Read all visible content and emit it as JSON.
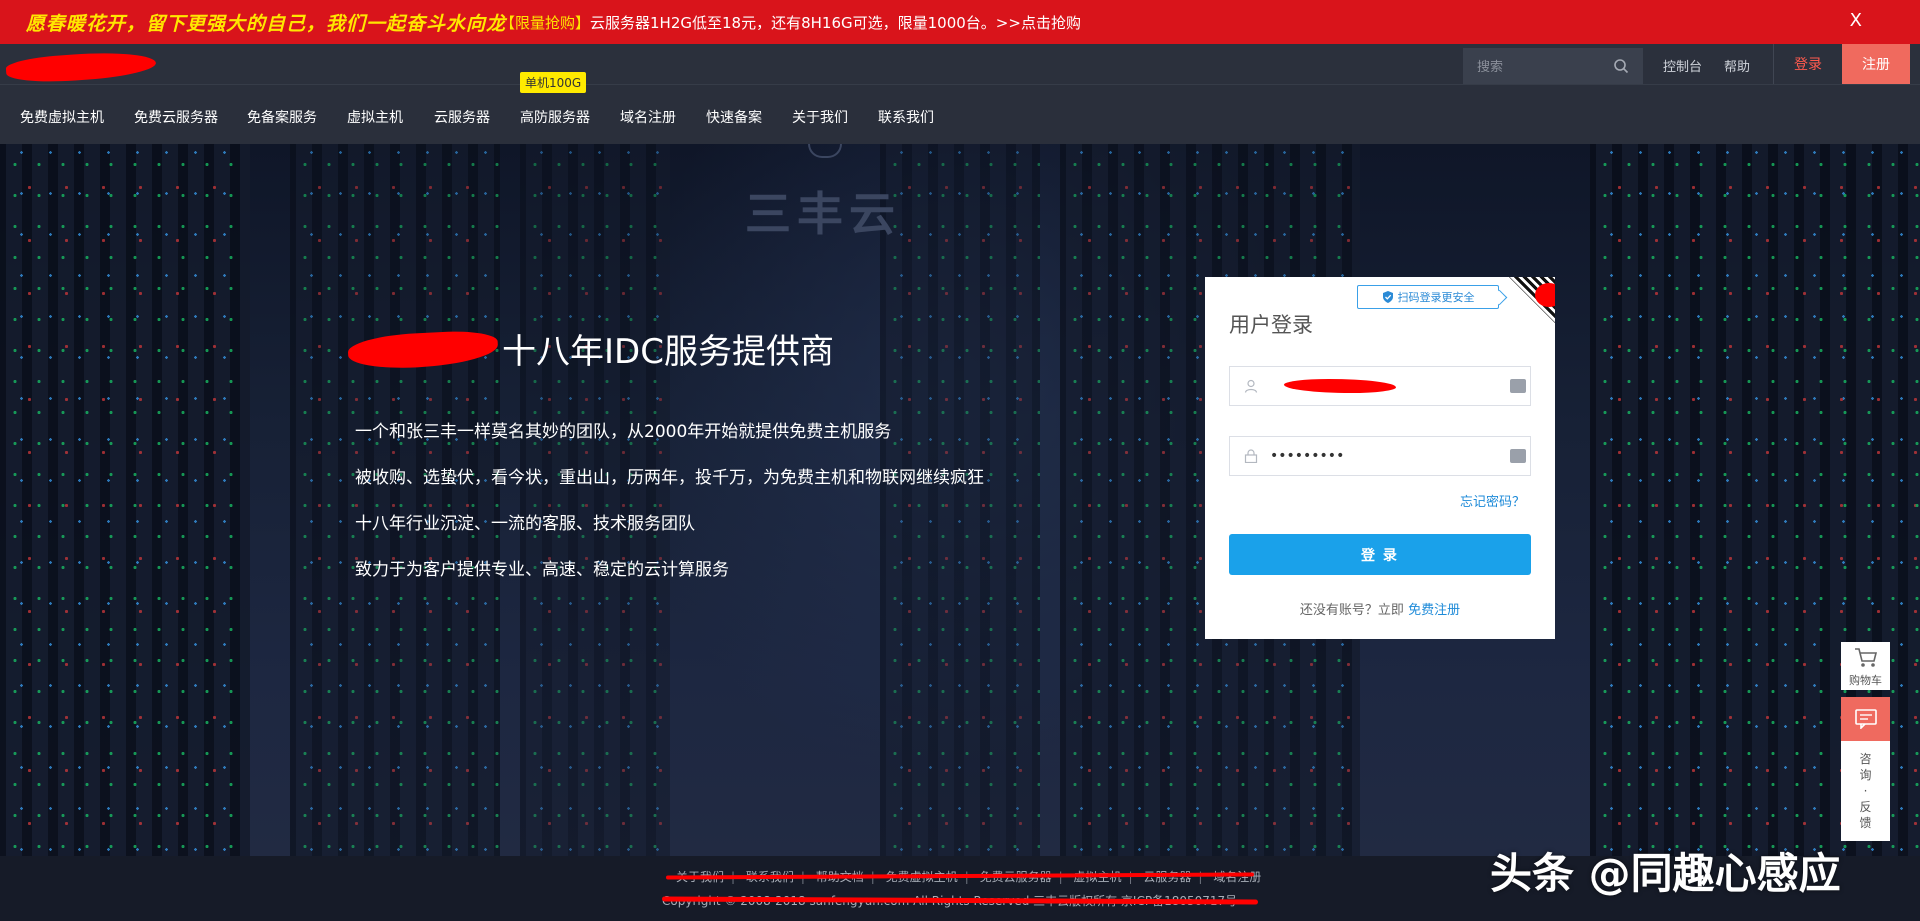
{
  "promo": {
    "slogan": "愿春暖花开，留下更强大的自己，我们一起奋斗水向龙",
    "tag": "【限量抢购】",
    "text": "云服务器1H2G低至18元，还有8H16G可选，限量1000台。>>点击抢购",
    "close": "X"
  },
  "header": {
    "search_placeholder": "搜索",
    "links": {
      "console": "控制台",
      "help": "帮助",
      "login": "登录",
      "register": "注册"
    }
  },
  "nav": {
    "items": [
      "免费虚拟主机",
      "免费云服务器",
      "免备案服务",
      "虚拟主机",
      "云服务器",
      "高防服务器",
      "域名注册",
      "快速备案",
      "关于我们",
      "联系我们"
    ],
    "badge": "单机100G"
  },
  "hero": {
    "wall_brand": "三丰云",
    "title": "十八年IDC服务提供商",
    "lines": [
      "一个和张三丰一样莫名其妙的团队，从2000年开始就提供免费主机服务",
      "被收购、选蛰伏，看今状，重出山，历两年，投千万，为免费主机和物联网继续疯狂",
      "十八年行业沉淀、一流的客服、技术服务团队",
      "致力于为客户提供专业、高速、稳定的云计算服务"
    ]
  },
  "login": {
    "qr_tip": "扫码登录更安全",
    "title": "用户登录",
    "password_value": "•••••••••",
    "forgot": "忘记密码？",
    "submit": "登 录",
    "no_account": "还没有账号？立即 ",
    "register_link": "免费注册"
  },
  "side": {
    "cart": "购物车",
    "feedback_chars": [
      "咨",
      "询",
      "·",
      "反",
      "馈"
    ]
  },
  "footer": {
    "links": [
      "关于我们",
      "联系我们",
      "帮助文档",
      "免费虚拟主机",
      "免费云服务器",
      "虚拟主机",
      "云服务器",
      "域名注册"
    ],
    "copyright": "Copyright © 2008-2018 sanfengyun.com All Rights Reserved 三丰云版权所有 京ICP备18050717号"
  },
  "watermark": "头条 @同趣心感应",
  "colors": {
    "promo_red": "#d9141b",
    "accent_blue": "#1aa1ea",
    "register_red": "#f06a5e"
  }
}
